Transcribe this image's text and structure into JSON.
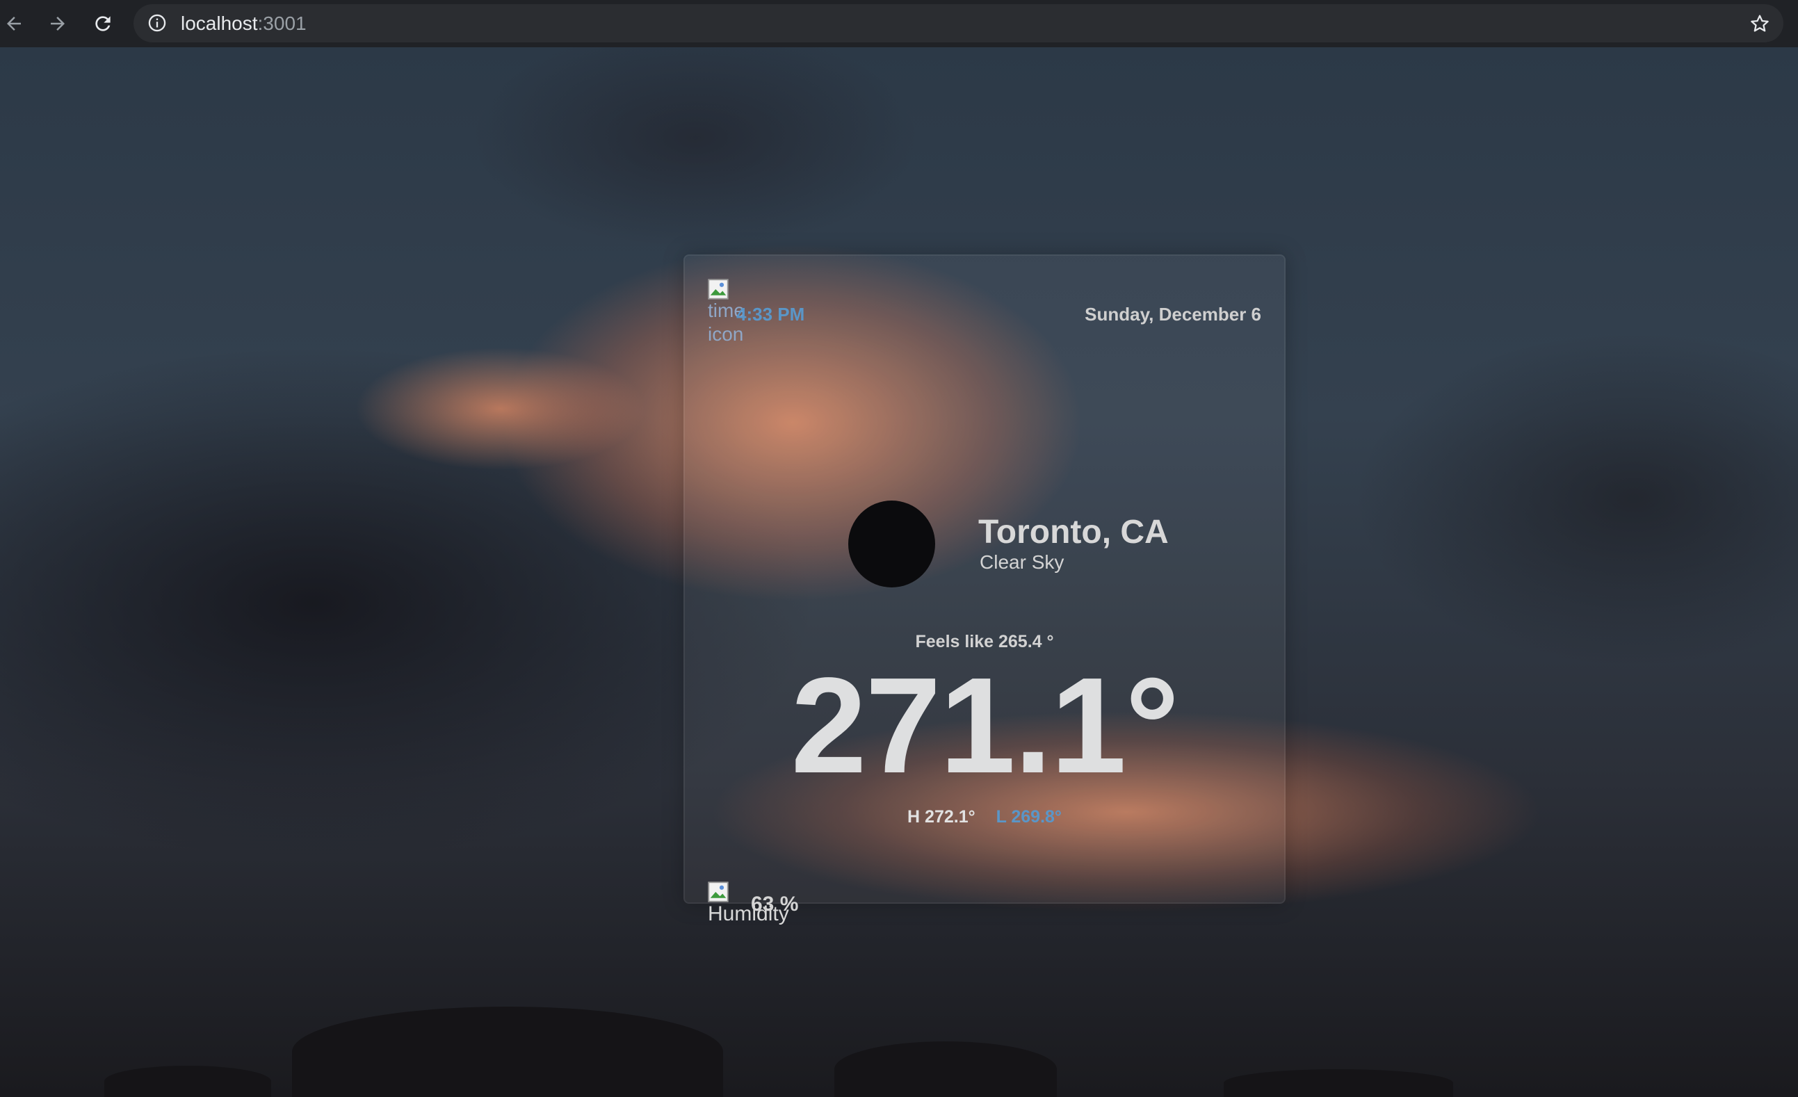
{
  "browser": {
    "url_host": "localhost",
    "url_port": ":3001"
  },
  "weather": {
    "time_icon_alt": "time icon",
    "time": "4:33 PM",
    "date": "Sunday, December 6",
    "city": "Toronto, CA",
    "condition": "Clear Sky",
    "feels_like": "Feels like 265.4 °",
    "temperature": "271.1°",
    "high": "H 272.1°",
    "low": "L 269.8°",
    "humidity_icon_alt": "Humidity",
    "humidity": "63 %"
  }
}
